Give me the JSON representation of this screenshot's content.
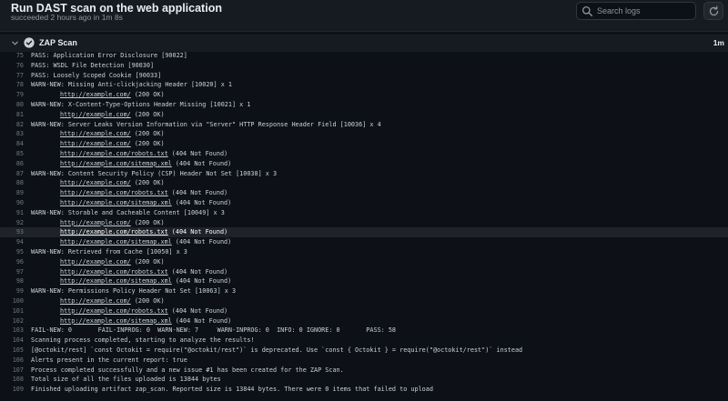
{
  "header": {
    "title": "Run DAST scan on the web application",
    "subtitle": "succeeded 2 hours ago in 1m 8s"
  },
  "search": {
    "placeholder": "Search logs"
  },
  "step": {
    "name": "ZAP Scan",
    "duration": "1m"
  },
  "colors": {
    "background": "#0d1117",
    "panel": "#161b22",
    "success": "#c9d1d9",
    "muted": "#8b949e"
  },
  "icons": {
    "search": "search-icon",
    "refresh": "refresh-icon",
    "chevron": "chevron-down-icon",
    "status": "check-circle-icon"
  },
  "log": [
    {
      "n": "75",
      "t": "PASS: Application Error Disclosure [90022]"
    },
    {
      "n": "76",
      "t": "PASS: WSDL File Detection [90030]"
    },
    {
      "n": "77",
      "t": "PASS: Loosely Scoped Cookie [90033]"
    },
    {
      "n": "78",
      "t": "WARN-NEW: Missing Anti-clickjacking Header [10020] x 1"
    },
    {
      "n": "79",
      "u": "http://example.com/",
      "s": " (200 OK)"
    },
    {
      "n": "80",
      "t": "WARN-NEW: X-Content-Type-Options Header Missing [10021] x 1"
    },
    {
      "n": "81",
      "u": "http://example.com/",
      "s": " (200 OK)"
    },
    {
      "n": "82",
      "t": "WARN-NEW: Server Leaks Version Information via \"Server\" HTTP Response Header Field [10036] x 4"
    },
    {
      "n": "83",
      "u": "http://example.com/",
      "s": " (200 OK)"
    },
    {
      "n": "84",
      "u": "http://example.com/",
      "s": " (200 OK)"
    },
    {
      "n": "85",
      "u": "http://example.com/robots.txt",
      "s": " (404 Not Found)"
    },
    {
      "n": "86",
      "u": "http://example.com/sitemap.xml",
      "s": " (404 Not Found)"
    },
    {
      "n": "87",
      "t": "WARN-NEW: Content Security Policy (CSP) Header Not Set [10038] x 3"
    },
    {
      "n": "88",
      "u": "http://example.com/",
      "s": " (200 OK)"
    },
    {
      "n": "89",
      "u": "http://example.com/robots.txt",
      "s": " (404 Not Found)"
    },
    {
      "n": "90",
      "u": "http://example.com/sitemap.xml",
      "s": " (404 Not Found)"
    },
    {
      "n": "91",
      "t": "WARN-NEW: Storable and Cacheable Content [10049] x 3"
    },
    {
      "n": "92",
      "u": "http://example.com/",
      "s": " (200 OK)"
    },
    {
      "n": "93",
      "u": "http://example.com/robots.txt",
      "s": " (404 Not Found)",
      "hl": true
    },
    {
      "n": "94",
      "u": "http://example.com/sitemap.xml",
      "s": " (404 Not Found)"
    },
    {
      "n": "95",
      "t": "WARN-NEW: Retrieved from Cache [10050] x 3"
    },
    {
      "n": "96",
      "u": "http://example.com/",
      "s": " (200 OK)"
    },
    {
      "n": "97",
      "u": "http://example.com/robots.txt",
      "s": " (404 Not Found)"
    },
    {
      "n": "98",
      "u": "http://example.com/sitemap.xml",
      "s": " (404 Not Found)"
    },
    {
      "n": "99",
      "t": "WARN-NEW: Permissions Policy Header Not Set [10063] x 3"
    },
    {
      "n": "100",
      "u": "http://example.com/",
      "s": " (200 OK)"
    },
    {
      "n": "101",
      "u": "http://example.com/robots.txt",
      "s": " (404 Not Found)"
    },
    {
      "n": "102",
      "u": "http://example.com/sitemap.xml",
      "s": " (404 Not Found)"
    },
    {
      "n": "103",
      "t": "FAIL-NEW: 0       FAIL-INPROG: 0  WARN-NEW: 7     WARN-INPROG: 0  INFO: 0 IGNORE: 0       PASS: 58"
    },
    {
      "n": "104",
      "t": "Scanning process completed, starting to analyze the results!"
    },
    {
      "n": "105",
      "t": "[@octokit/rest] `const Octokit = require(\"@octokit/rest\")` is deprecated. Use `const { Octokit } = require(\"@octokit/rest\")` instead"
    },
    {
      "n": "106",
      "t": "Alerts present in the current report: true"
    },
    {
      "n": "107",
      "t": "Process completed successfully and a new issue #1 has been created for the ZAP Scan."
    },
    {
      "n": "108",
      "t": "Total size of all the files uploaded is 13844 bytes"
    },
    {
      "n": "109",
      "t": "Finished uploading artifact zap_scan. Reported size is 13844 bytes. There were 0 items that failed to upload"
    }
  ]
}
